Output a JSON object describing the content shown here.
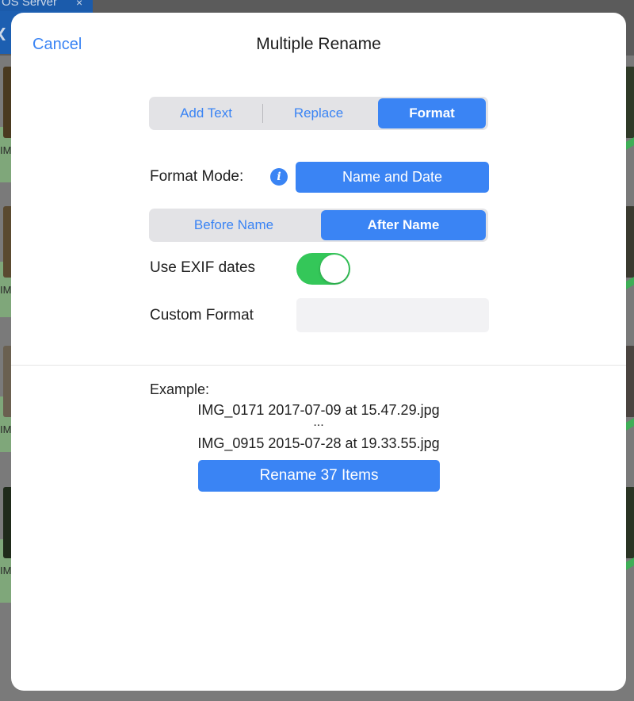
{
  "background": {
    "tab_title": "OS Server",
    "tab_close": "×",
    "captions": [
      "IMG",
      "IM",
      "IM",
      "IM"
    ]
  },
  "dialog": {
    "cancel_label": "Cancel",
    "title": "Multiple Rename",
    "mode_tabs": [
      {
        "label": "Add Text",
        "active": false
      },
      {
        "label": "Replace",
        "active": false
      },
      {
        "label": "Format",
        "active": true
      }
    ],
    "format_mode_label": "Format Mode:",
    "format_mode_value": "Name and Date",
    "position_tabs": [
      {
        "label": "Before Name",
        "active": false
      },
      {
        "label": "After Name",
        "active": true
      }
    ],
    "exif_label": "Use EXIF dates",
    "exif_enabled": true,
    "custom_format_label": "Custom Format",
    "custom_format_value": "",
    "example_label": "Example:",
    "example_first": "IMG_0171 2017-07-09 at 15.47.29.jpg",
    "example_ellipsis": "...",
    "example_last": "IMG_0915 2015-07-28 at 19.33.55.jpg",
    "rename_button_label": "Rename 37 Items"
  },
  "colors": {
    "accent": "#3a84f4",
    "toggle_on": "#34c759"
  }
}
